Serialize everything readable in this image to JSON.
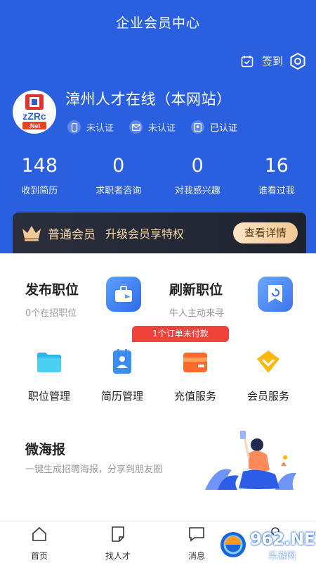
{
  "header": {
    "title": "企业会员中心",
    "signin_label": "签到",
    "company_name": "漳州人才在线（本网站）",
    "logo_text": "zZRc.Net",
    "verifications": [
      {
        "label": "未认证",
        "icon": "phone-icon",
        "verified": false
      },
      {
        "label": "未认证",
        "icon": "mail-icon",
        "verified": false
      },
      {
        "label": "已认证",
        "icon": "license-icon",
        "verified": true
      }
    ],
    "colors": {
      "primary": "#2a5fe0"
    }
  },
  "stats": [
    {
      "value": "148",
      "label": "收到简历"
    },
    {
      "value": "0",
      "label": "求职者咨询"
    },
    {
      "value": "0",
      "label": "对我感兴趣"
    },
    {
      "value": "16",
      "label": "谁看过我"
    }
  ],
  "membership": {
    "type": "普通会员",
    "promo": "升级会员享特权",
    "details_button": "查看详情"
  },
  "features": [
    {
      "title": "发布职位",
      "subtitle": "0个在招职位",
      "icon": "briefcase-icon"
    },
    {
      "title": "刷新职位",
      "subtitle": "牛人主动来寻",
      "icon": "refresh-icon"
    }
  ],
  "unpaid_badge": "1个订单未付款",
  "grid": [
    {
      "label": "职位管理",
      "icon": "folder-icon"
    },
    {
      "label": "简历管理",
      "icon": "resume-icon"
    },
    {
      "label": "充值服务",
      "icon": "wallet-icon"
    },
    {
      "label": "会员服务",
      "icon": "diamond-icon"
    }
  ],
  "poster": {
    "title": "微海报",
    "subtitle": "一键生成招聘海报，分享到朋友圈"
  },
  "tabbar": [
    {
      "label": "首页",
      "icon": "home-icon"
    },
    {
      "label": "找人才",
      "icon": "document-icon"
    },
    {
      "label": "消息",
      "icon": "message-icon"
    },
    {
      "label": "",
      "icon": "profile-icon"
    }
  ],
  "watermark": {
    "text": "962.NET",
    "sub": "乐游网"
  }
}
